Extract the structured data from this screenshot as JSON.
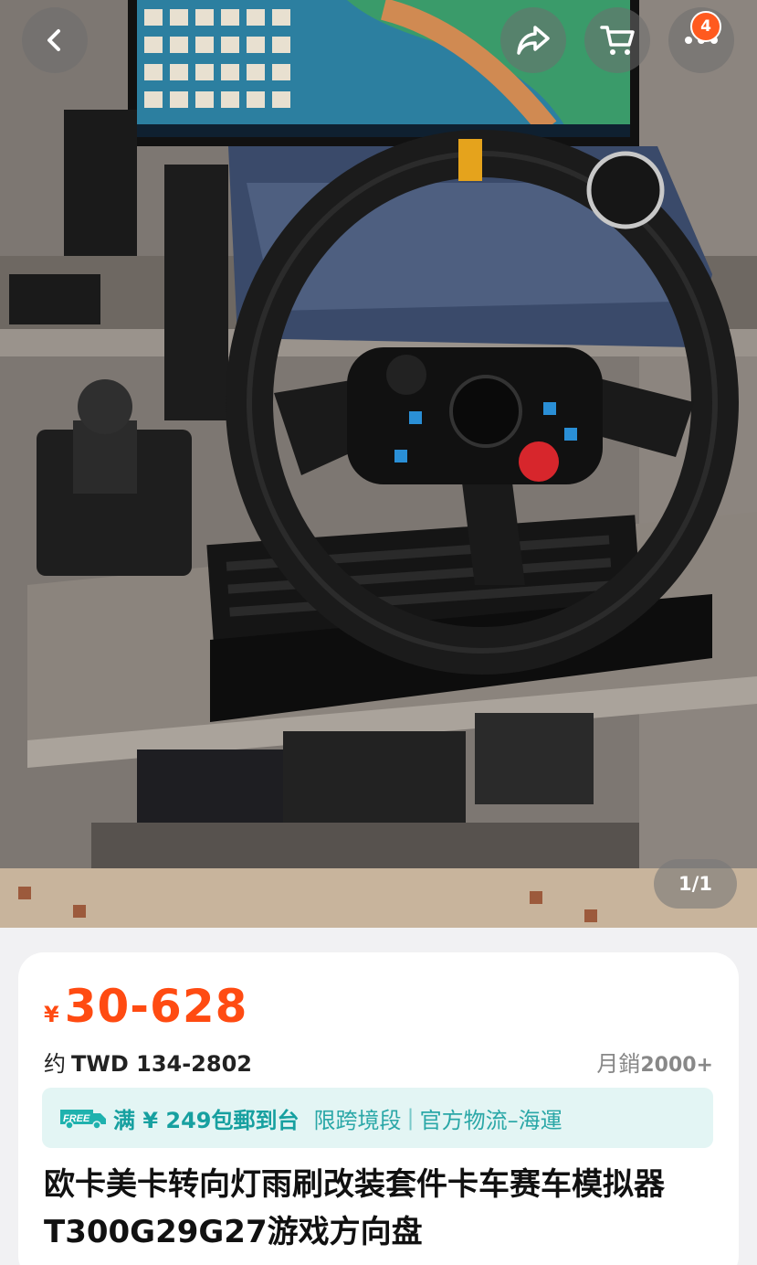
{
  "header": {
    "back_icon": "chevron-left-icon",
    "share_icon": "share-icon",
    "cart_icon": "cart-icon",
    "more_icon": "more-icon",
    "cart_badge": "4"
  },
  "gallery": {
    "counter": "1/1"
  },
  "product": {
    "price_symbol": "¥",
    "price": "30-628",
    "approx_label": "约",
    "twd_price": "TWD 134-2802",
    "sales_label": "月銷",
    "sales_count": "2000+",
    "shipping": {
      "free_badge": "FREE",
      "main": "满 ¥ 249包郵到台",
      "sub1": "限跨境段",
      "separator": "|",
      "sub2": "官方物流–海運"
    },
    "title": "欧卡美卡转向灯雨刷改装套件卡车赛车模拟器T300G29G27游戏方向盘"
  },
  "colors": {
    "price": "#ff4b12",
    "shipping_accent": "#17a0a0",
    "shipping_bg": "#e3f5f4",
    "badge": "#ff5a1f"
  }
}
